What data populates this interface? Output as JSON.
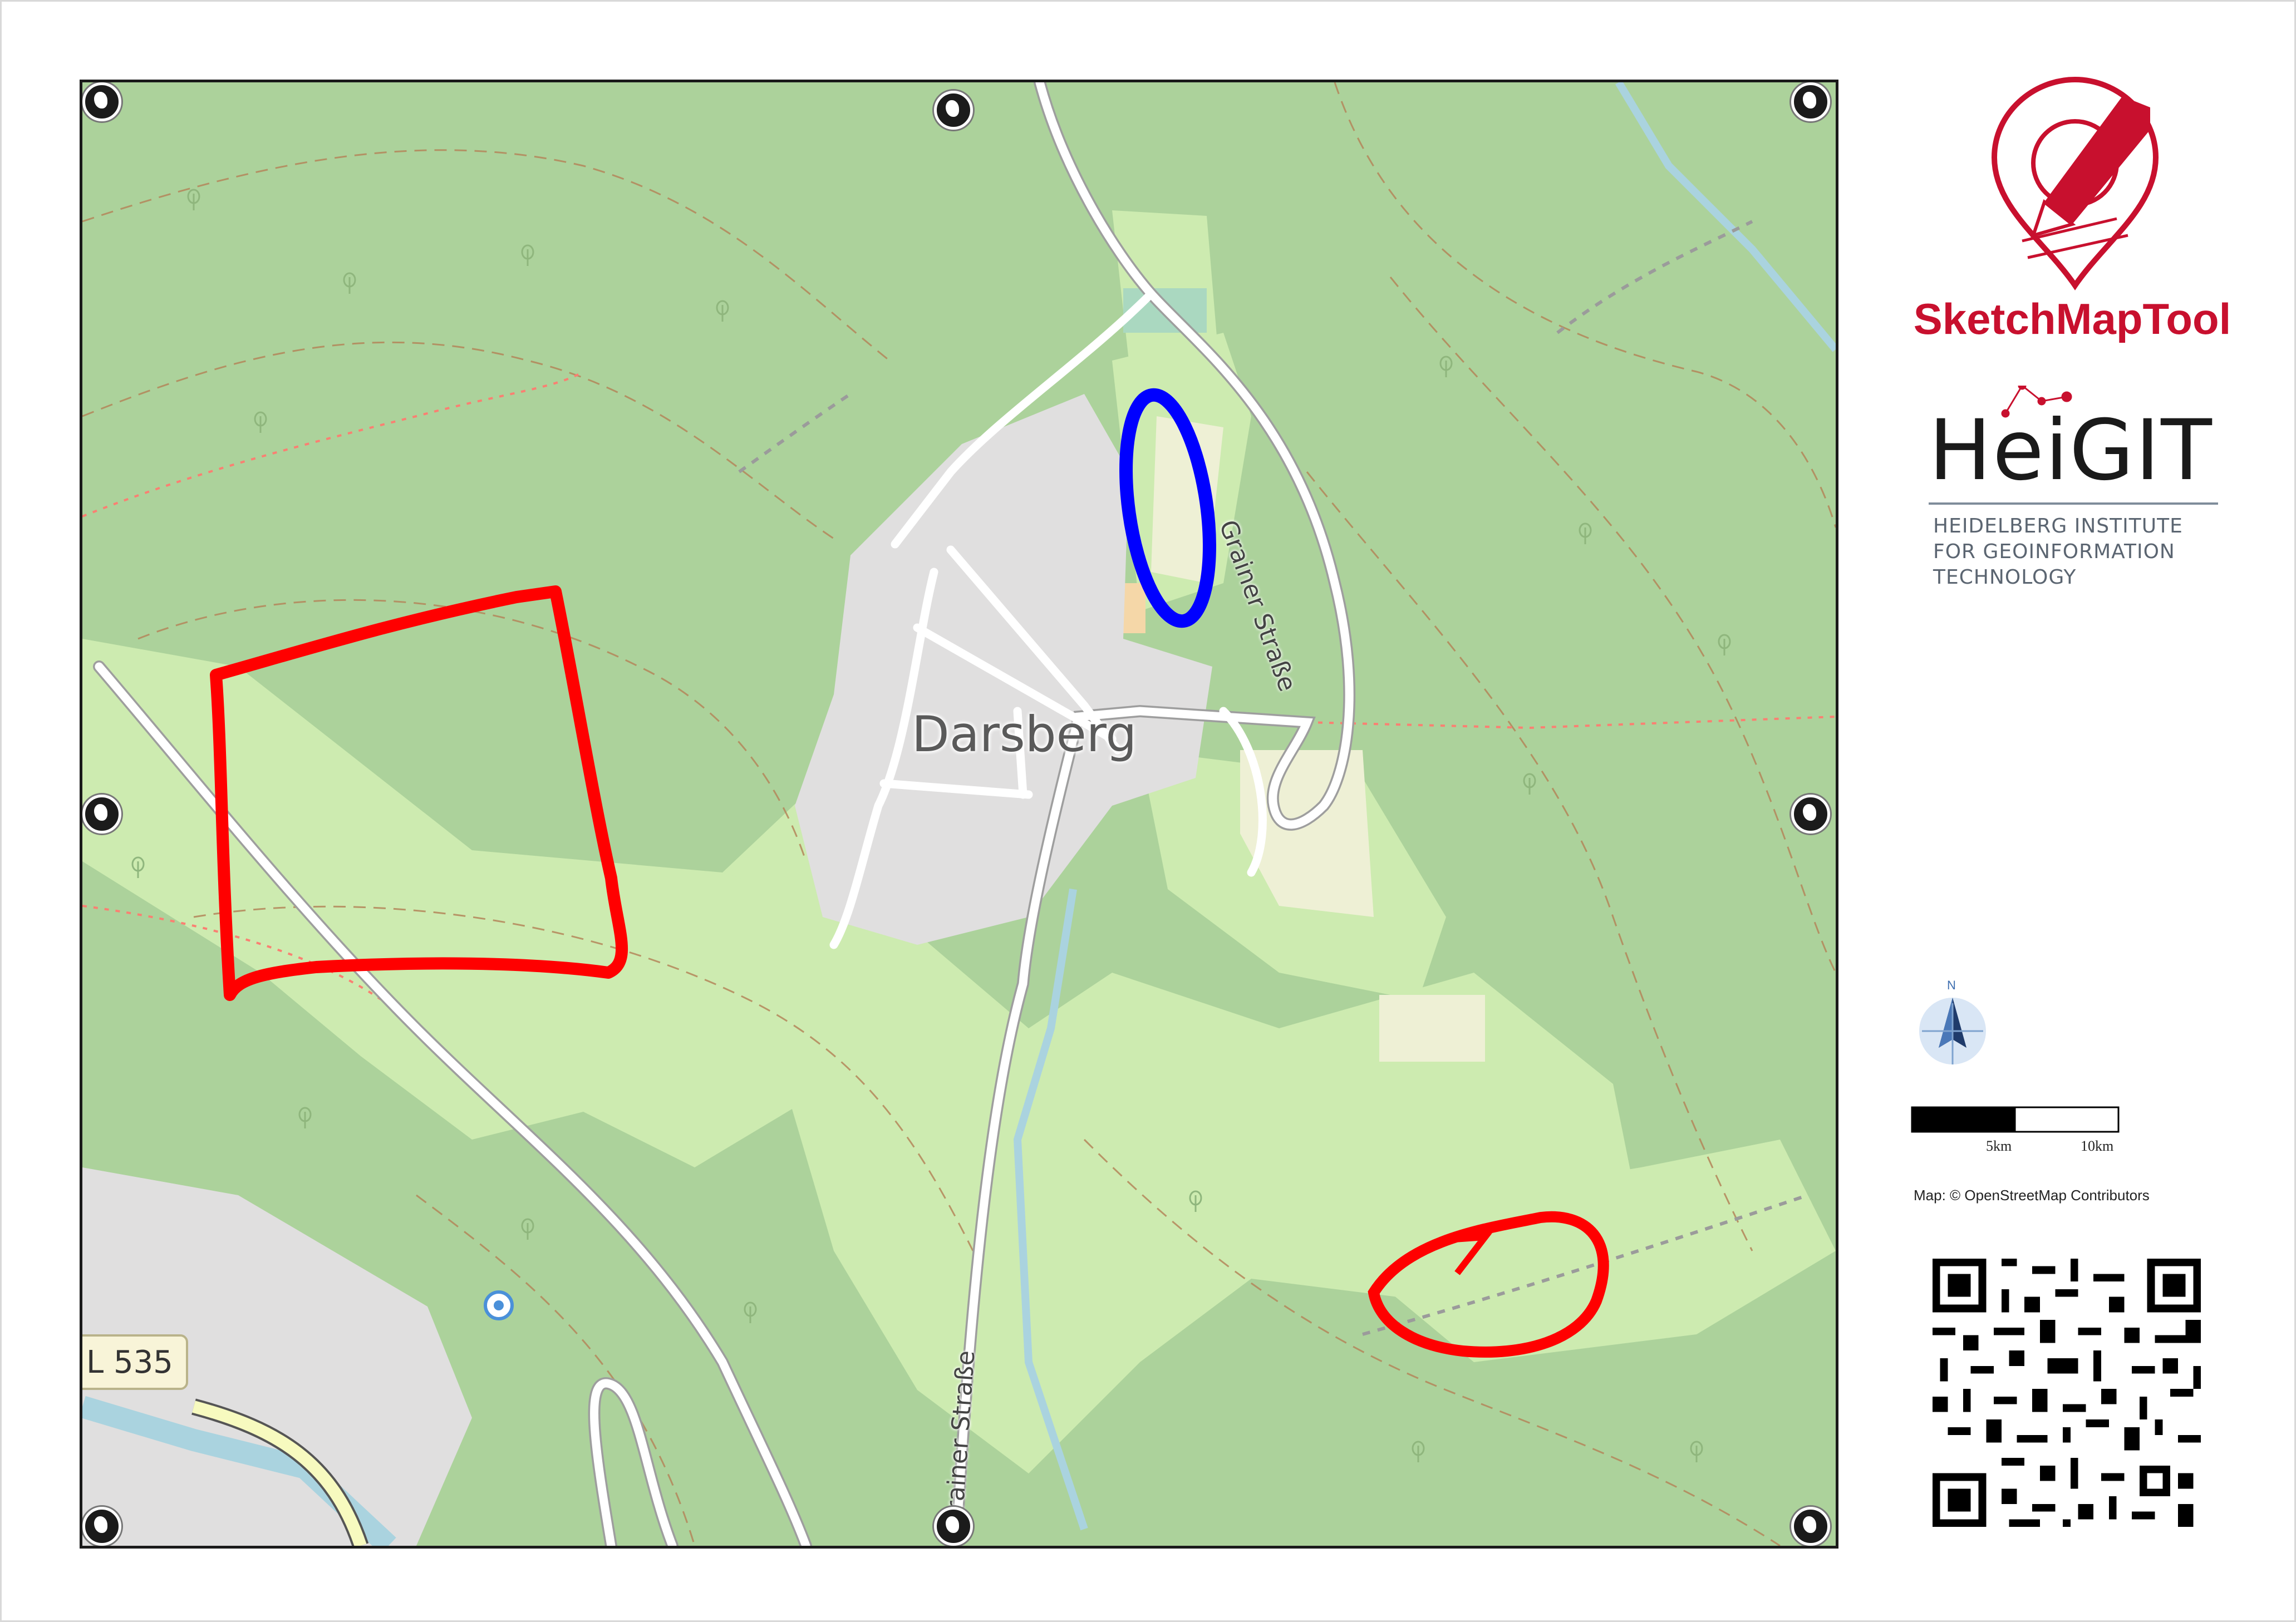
{
  "map": {
    "place_name": "Darsberg",
    "street_top": "Grainer Straße",
    "street_bottom": "Grainer Straße",
    "road_shield": "L 535",
    "attribution": "Map: © OpenStreetMap Contributors",
    "colors": {
      "forest": "#acd29b",
      "meadow": "#cdebb0",
      "farmland": "#eef0d5",
      "residential": "#e0dfdf",
      "road": "#ffffff",
      "water": "#aad3df",
      "contour": "#b4865a",
      "sketch_red": "#ff0000",
      "sketch_blue": "#0000ff"
    },
    "sketches": [
      {
        "shape": "quadrilateral",
        "color": "red"
      },
      {
        "shape": "ellipse",
        "color": "blue"
      },
      {
        "shape": "ellipse",
        "color": "red"
      }
    ],
    "corner_markers": [
      "globe-marker",
      "globe-marker",
      "globe-marker",
      "globe-marker",
      "globe-marker",
      "globe-marker",
      "globe-marker",
      "globe-marker"
    ]
  },
  "branding": {
    "tool_name": "SketchMapTool",
    "org_name": "HeiGIT",
    "org_full": [
      "HEIDELBERG INSTITUTE",
      "FOR GEOINFORMATION",
      "TECHNOLOGY"
    ],
    "brand_red": "#c8102e"
  },
  "north_arrow": {
    "label": "N"
  },
  "scale": {
    "labels": [
      "5km",
      "10km"
    ]
  },
  "qr": {
    "icon": "qr-code"
  }
}
